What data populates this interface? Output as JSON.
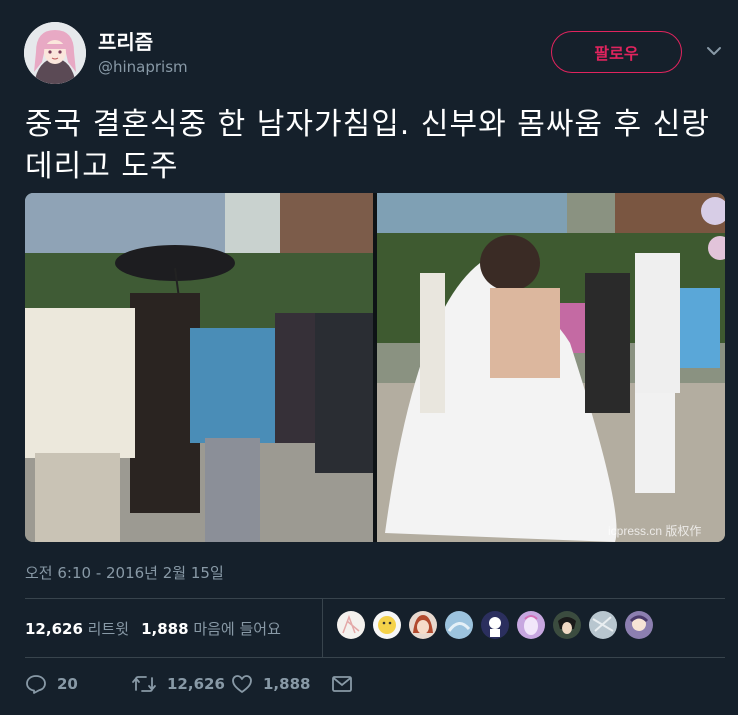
{
  "user": {
    "display_name": "프리즘",
    "handle": "@hinaprism",
    "follow_label": "팔로우"
  },
  "tweet": {
    "text": "중국 결혼식중 한 남자가침입. 신부와 몸싸움 후 신랑 데리고 도주",
    "timestamp": "오전 6:10 - 2016년 2월 15일",
    "watermark": "icpress.cn 版权作"
  },
  "stats": {
    "retweets_count": "12,626",
    "retweets_label": "리트윗",
    "likes_count": "1,888",
    "likes_label": "마음에 들어요"
  },
  "actions": {
    "reply_count": "20",
    "retweet_count": "12,626",
    "like_count": "1,888"
  },
  "colors": {
    "background": "#15202b",
    "secondary_text": "#8899a6",
    "follow_accent": "#e0245e",
    "divider": "#38444d"
  }
}
